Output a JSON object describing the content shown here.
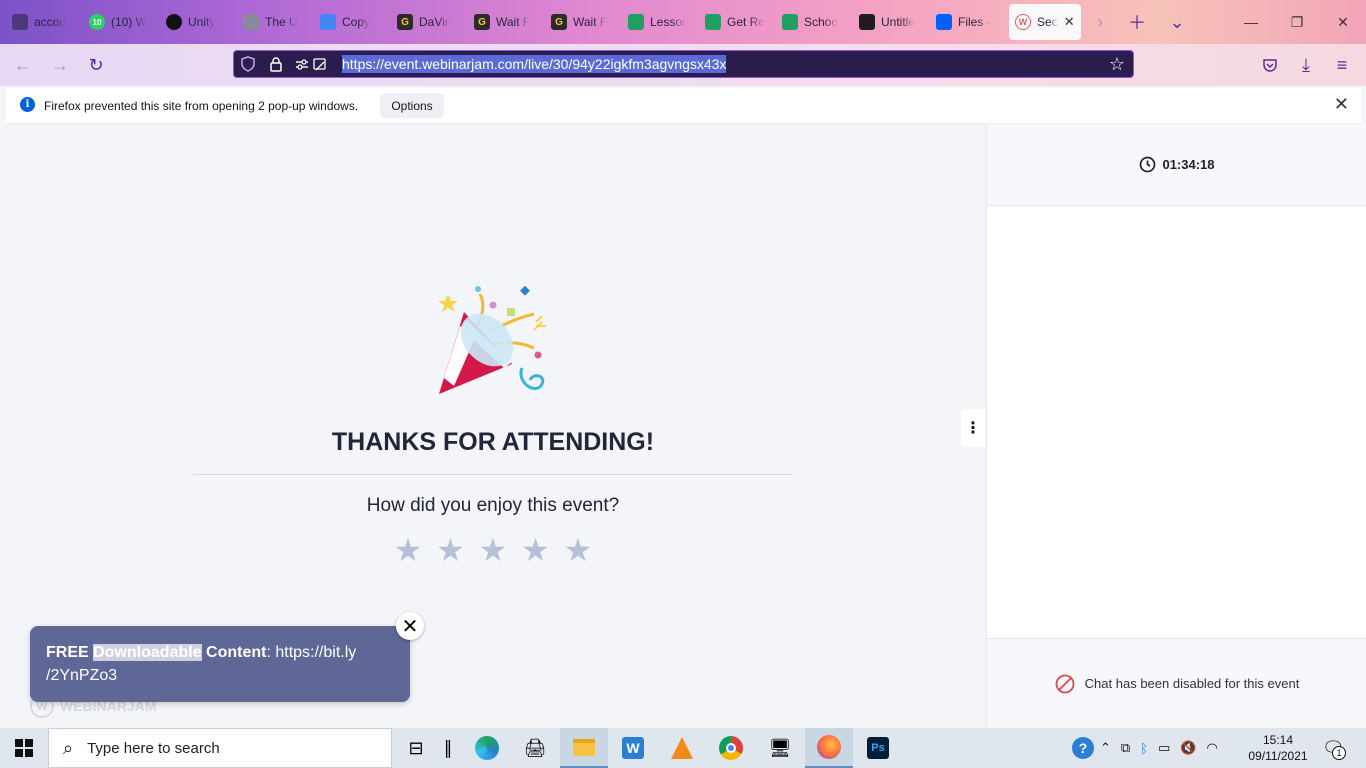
{
  "browser": {
    "tabs": [
      {
        "label": "accou",
        "icon": "back-circle-icon",
        "color": "#4a3a7a"
      },
      {
        "label": "(10) W",
        "icon": "whatsapp-icon",
        "color": "#25d366",
        "badge": "10"
      },
      {
        "label": "Unity",
        "icon": "unity-icon",
        "color": "#111111"
      },
      {
        "label": "The U",
        "icon": "unity-cube-icon",
        "color": "#8a8a9a"
      },
      {
        "label": "Copy",
        "icon": "docs-icon",
        "color": "#4285f4"
      },
      {
        "label": "DaVin",
        "icon": "g-logo-icon",
        "color": "#2b2b2b"
      },
      {
        "label": "Wait F",
        "icon": "g-logo-icon",
        "color": "#2b2b2b"
      },
      {
        "label": "Wait F",
        "icon": "g-logo-icon",
        "color": "#2b2b2b"
      },
      {
        "label": "Lessor",
        "icon": "mountain-icon",
        "color": "#1fa060"
      },
      {
        "label": "Get Re",
        "icon": "mountain-icon",
        "color": "#1fa060"
      },
      {
        "label": "Schoo",
        "icon": "mountain-icon",
        "color": "#1fa060"
      },
      {
        "label": "Untitle",
        "icon": "figma-icon",
        "color": "#1e1e1e"
      },
      {
        "label": "Files -",
        "icon": "dropbox-icon",
        "color": "#0061fe"
      }
    ],
    "active_tab": {
      "label": "Sec",
      "icon": "webinarjam-icon"
    },
    "url": "https://event.webinarjam.com/live/30/94y22igkfm3agvngsx43x",
    "notification": {
      "text": "Firefox prevented this site from opening 2 pop-up windows.",
      "options_label": "Options"
    }
  },
  "event": {
    "timer": "01:34:18",
    "heading": "THANKS FOR ATTENDING!",
    "question": "How did you enjoy this event?",
    "rating": {
      "max": 5,
      "value": 0
    },
    "chat_status": "Chat has been disabled for this event",
    "popup": {
      "prefix": "FREE ",
      "highlight": "Downloadable",
      "middle": " Content",
      "suffix": ": https://bit.ly /2YnPZo3"
    },
    "brand": "WEBINARJAM"
  },
  "taskbar": {
    "search_placeholder": "Type here to search",
    "time": "15:14",
    "date": "09/11/2021",
    "notification_count": "1"
  },
  "colors": {
    "accent": "#5b2aa0",
    "popup_bg": "#5e6796",
    "star": "#b6c0da",
    "heading": "#24243a"
  }
}
